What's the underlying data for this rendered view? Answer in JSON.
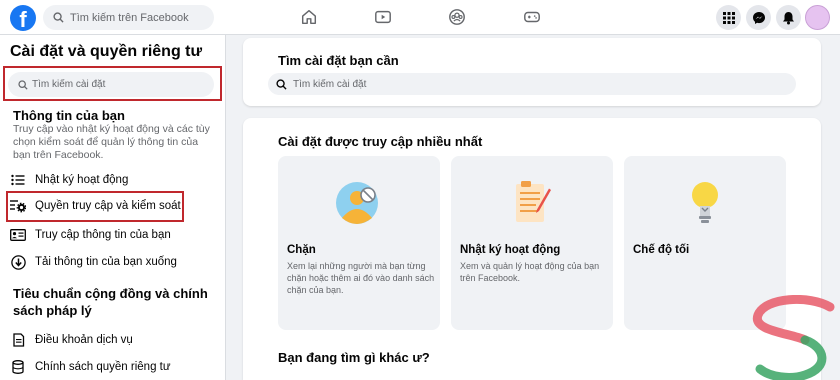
{
  "topbar": {
    "logo": "f",
    "search_placeholder": "Tìm kiếm trên Facebook",
    "nav_icons": [
      "home-icon",
      "watch-icon",
      "groups-icon",
      "gaming-icon"
    ],
    "right_icons": [
      "menu-grid-icon",
      "messenger-icon",
      "bell-icon",
      "avatar"
    ]
  },
  "sidebar": {
    "title": "Cài đặt và quyền riêng tư",
    "search_placeholder": "Tìm kiếm cài đặt",
    "section1": {
      "title": "Thông tin của bạn",
      "desc": "Truy cập vào nhật ký hoạt động và các tùy chọn kiểm soát để quản lý thông tin của bạn trên Facebook.",
      "items": [
        {
          "label": "Nhật ký hoạt động"
        },
        {
          "label": "Quyền truy cập và kiểm soát"
        },
        {
          "label": "Truy cập thông tin của bạn"
        },
        {
          "label": "Tải thông tin của bạn xuống"
        }
      ]
    },
    "section2": {
      "title": "Tiêu chuẩn cộng đồng và chính sách pháp lý",
      "items": [
        {
          "label": "Điều khoản dịch vụ"
        },
        {
          "label": "Chính sách quyền riêng tư"
        }
      ]
    }
  },
  "main": {
    "search_card": {
      "title": "Tìm cài đặt bạn cần",
      "placeholder": "Tìm kiếm cài đặt"
    },
    "most_used": {
      "title": "Cài đặt được truy cập nhiều nhất",
      "tiles": [
        {
          "title": "Chặn",
          "desc": "Xem lại những người mà bạn từng chặn hoặc thêm ai đó vào danh sách chặn của bạn."
        },
        {
          "title": "Nhật ký hoạt động",
          "desc": "Xem và quản lý hoạt động của bạn trên Facebook."
        },
        {
          "title": "Chế độ tối",
          "desc": ""
        }
      ]
    },
    "other_title": "Bạn đang tìm gì khác ư?"
  },
  "colors": {
    "brand": "#1877f2",
    "highlight": "#c0282d"
  }
}
